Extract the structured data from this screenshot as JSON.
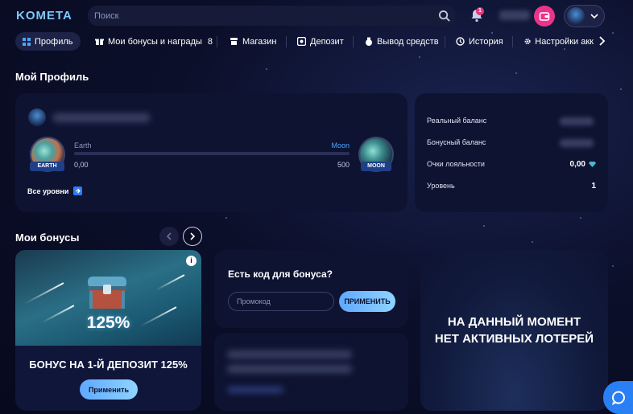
{
  "header": {
    "logo": "KOMETA",
    "search_placeholder": "Поиск",
    "notifications_count": "1"
  },
  "tabs": [
    {
      "label": "Профиль",
      "icon": "grid-icon",
      "active": true
    },
    {
      "label": "Мои бонусы и награды",
      "icon": "gift-icon",
      "count": "8"
    },
    {
      "label": "Магазин",
      "icon": "shop-icon"
    },
    {
      "label": "Депозит",
      "icon": "deposit-icon"
    },
    {
      "label": "Вывод средств",
      "icon": "money-bag-icon"
    },
    {
      "label": "История",
      "icon": "history-icon"
    },
    {
      "label": "Настройки акк",
      "icon": "gear-icon"
    }
  ],
  "profile": {
    "title": "Мой Профиль",
    "level_from": "Earth",
    "level_to": "Moon",
    "level_from_badge": "EARTH",
    "level_to_badge": "MOON",
    "points_from": "0,00",
    "points_to": "500",
    "progress": 0,
    "all_levels": "Все уровни"
  },
  "stats": {
    "real_balance_label": "Реальный баланс",
    "bonus_balance_label": "Бонусный баланс",
    "loyalty_label": "Очки лояльности",
    "loyalty_value": "0,00",
    "level_label": "Уровень",
    "level_value": "1"
  },
  "bonuses": {
    "title": "Мои бонусы",
    "card": {
      "percent": "125%",
      "title": "БОНУС НА 1-Й ДЕПОЗИТ 125%",
      "button": "Применить"
    }
  },
  "promo": {
    "title": "Есть код для бонуса?",
    "placeholder": "Промокод",
    "button": "ПРИМЕНИТЬ"
  },
  "lottery": {
    "line1": "НА ДАННЫЙ МОМЕНТ",
    "line2": "НЕТ АКТИВНЫХ ЛОТЕРЕЙ"
  },
  "colors": {
    "accent": "#4da6ff",
    "pink": "#e8358a",
    "background": "#0b0f2a",
    "card": "#0e1331"
  }
}
